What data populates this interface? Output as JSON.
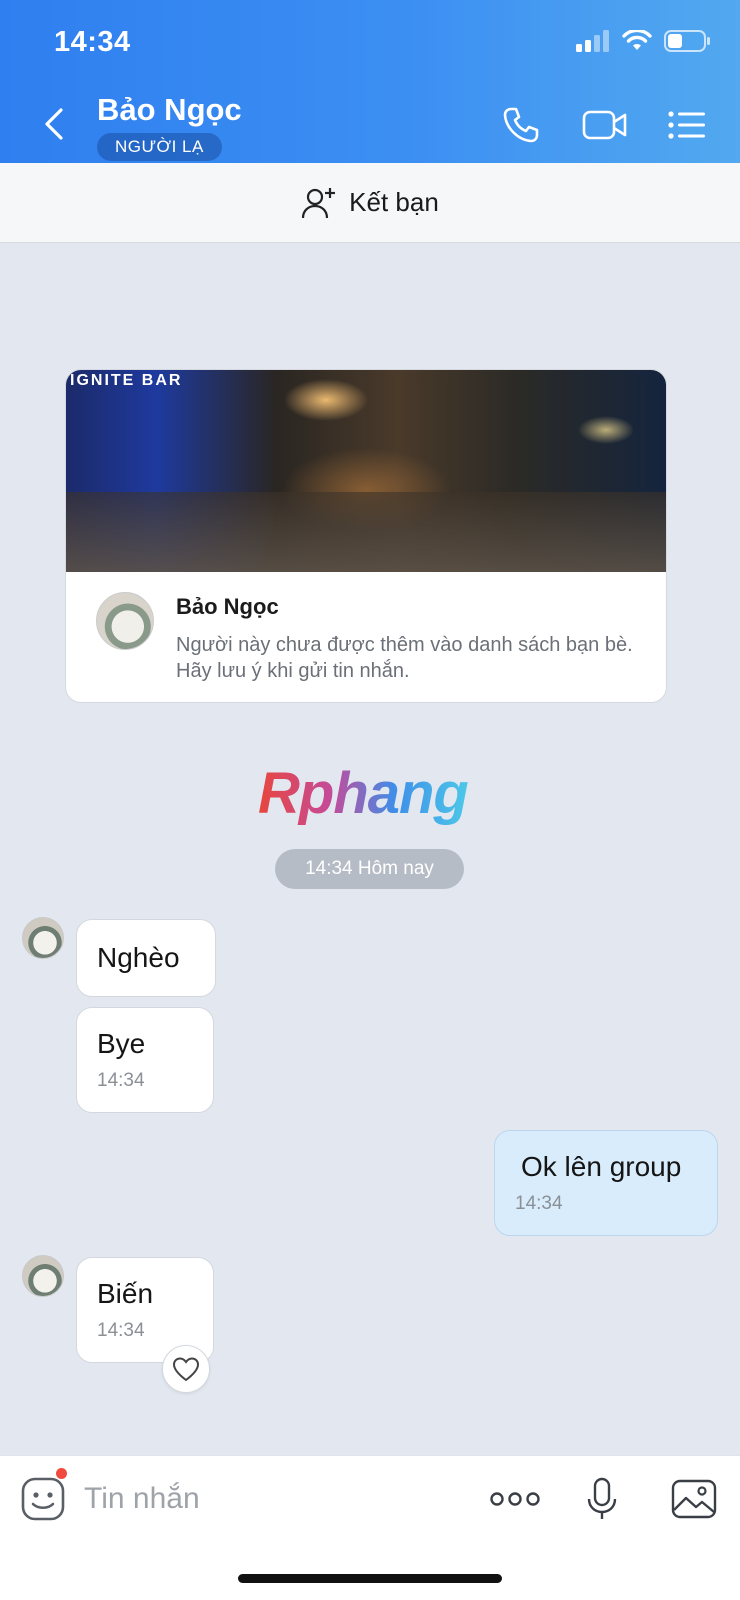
{
  "status_bar": {
    "time": "14:34"
  },
  "header": {
    "contact_name": "Bảo Ngọc",
    "badge": "NGƯỜI LẠ"
  },
  "add_friend": {
    "label": "Kết bạn"
  },
  "profile_card": {
    "cover_sign": "IGNITE BAR",
    "name": "Bảo Ngọc",
    "note": "Người này chưa được thêm vào danh sách bạn bè. Hãy lưu ý khi gửi tin nhắn."
  },
  "watermark": "Rphang",
  "time_divider": "14:34 Hôm nay",
  "messages": [
    {
      "direction": "received",
      "text": "Nghèo",
      "time": ""
    },
    {
      "direction": "received",
      "text": "Bye",
      "time": "14:34"
    },
    {
      "direction": "sent",
      "text": "Ok lên group",
      "time": "14:34"
    },
    {
      "direction": "received",
      "text": "Biến",
      "time": "14:34"
    }
  ],
  "composer": {
    "placeholder": "Tin nhắn"
  },
  "icons": {
    "back": "chevron-left-icon",
    "call": "phone-icon",
    "video": "video-camera-icon",
    "menu": "list-menu-icon",
    "add_friend": "add-user-icon",
    "like": "heart-icon",
    "emoji": "sticker-emoji-icon",
    "more": "more-dots-icon",
    "mic": "microphone-icon",
    "image": "image-icon"
  },
  "colors": {
    "header_start": "#2f7ff0",
    "header_end": "#52a9f0",
    "chat_bg": "#e3e8f0",
    "sent_bubble": "#d8ecfb",
    "notification_dot": "#f04b3e"
  }
}
